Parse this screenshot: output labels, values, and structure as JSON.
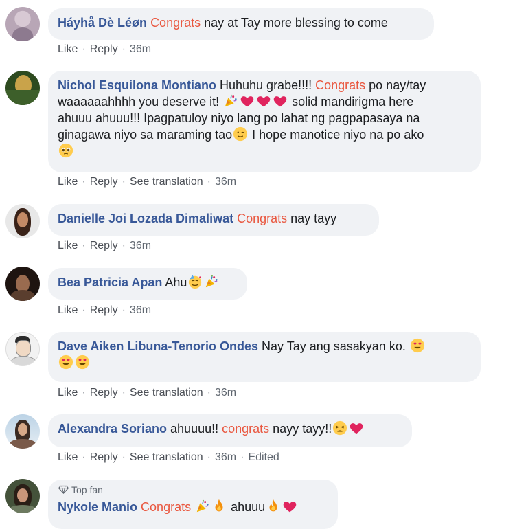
{
  "actions": {
    "like": "Like",
    "reply": "Reply",
    "see_translation": "See translation",
    "edited": "Edited"
  },
  "comments": [
    {
      "name": "Háyhå Dè Léøn",
      "hl": "Congrats",
      "text": " nay at Tay more blessing to come",
      "time": "36m"
    },
    {
      "name": "Nichol Esquilona Montiano",
      "t1": " Huhuhu grabe!!!! ",
      "hl": "Congrats",
      "t2": " po nay/tay",
      "t3": "waaaaaahhhh you deserve it! ",
      "t4": " solid mandirigma here",
      "t5": "ahuuu ahuuu!!! Ipagpatuloy niyo lang po lahat ng pagpapasaya na",
      "t6": "ginagawa niyo sa maraming tao",
      "t7": " I hope manotice niyo na po ako",
      "time": "36m"
    },
    {
      "name": "Danielle Joi Lozada Dimaliwat",
      "hl": "Congrats",
      "text": " nay tayy",
      "time": "36m"
    },
    {
      "name": "Bea Patricia Apan",
      "text": " Ahu",
      "time": "36m"
    },
    {
      "name": "Dave Aiken Libuna-Tenorio Ondes",
      "text": " Nay Tay ang sasakyan ko. ",
      "time": "36m"
    },
    {
      "name": "Alexandra Soriano",
      "text": " ahuuuu!! ",
      "hl": "congrats",
      "text2": " nayy tayy!!",
      "time": "36m"
    },
    {
      "badge": "Top fan",
      "name": "Nykole Manio",
      "hl": "Congrats",
      "text": " ahuuu",
      "time": ""
    }
  ],
  "colors": {
    "name": "#385898",
    "highlight": "#e9573f",
    "bubble": "#f0f2f5",
    "meta": "#606770"
  }
}
